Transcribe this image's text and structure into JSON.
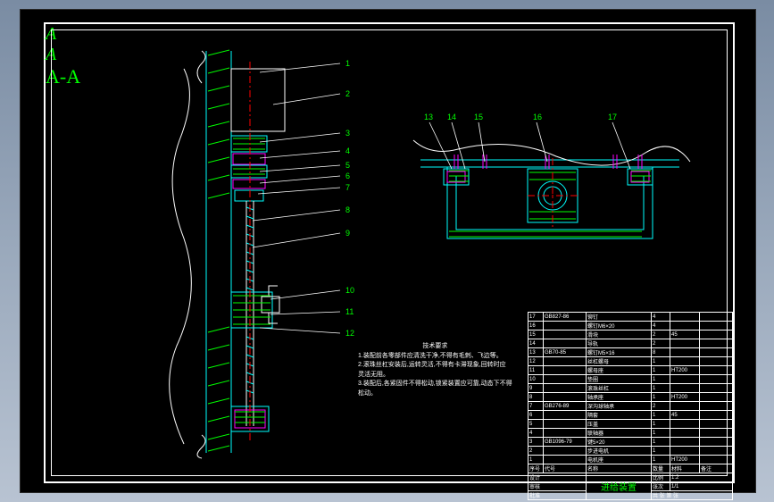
{
  "section_marker": "A",
  "section_label": "A-A",
  "callouts_left": [
    "1",
    "2",
    "3",
    "4",
    "5",
    "6",
    "7",
    "8",
    "9",
    "10",
    "11",
    "12"
  ],
  "callouts_right": [
    "13",
    "14",
    "15",
    "16",
    "17"
  ],
  "notes": {
    "title": "技术要求",
    "line1": "1.装配前各零部件应清洗干净,不得有毛刺、飞边等。",
    "line2": "2.滚珠丝杠安装后,运转灵活,不得有卡滞现象,回转时应",
    "line2b": "  灵活无阻。",
    "line3": "3.装配后,各紧固件不得松动,锁紧装置应可靠,动态下不得",
    "line3b": "  松动。"
  },
  "bom": [
    {
      "no": "17",
      "code": "GB827-86",
      "name": "铆钉",
      "qty": "4",
      "mat": "",
      "note": ""
    },
    {
      "no": "16",
      "code": "",
      "name": "螺钉M6×20",
      "qty": "4",
      "mat": "",
      "note": ""
    },
    {
      "no": "15",
      "code": "",
      "name": "滑块",
      "qty": "2",
      "mat": "45",
      "note": ""
    },
    {
      "no": "14",
      "code": "",
      "name": "导轨",
      "qty": "2",
      "mat": "",
      "note": ""
    },
    {
      "no": "13",
      "code": "GB70-85",
      "name": "螺钉M5×16",
      "qty": "8",
      "mat": "",
      "note": ""
    },
    {
      "no": "12",
      "code": "",
      "name": "丝杠螺母",
      "qty": "1",
      "mat": "",
      "note": ""
    },
    {
      "no": "11",
      "code": "",
      "name": "螺母座",
      "qty": "1",
      "mat": "HT200",
      "note": ""
    },
    {
      "no": "10",
      "code": "",
      "name": "垫圈",
      "qty": "1",
      "mat": "",
      "note": ""
    },
    {
      "no": "9",
      "code": "",
      "name": "滚珠丝杠",
      "qty": "1",
      "mat": "",
      "note": ""
    },
    {
      "no": "8",
      "code": "",
      "name": "轴承座",
      "qty": "1",
      "mat": "HT200",
      "note": ""
    },
    {
      "no": "7",
      "code": "GB276-89",
      "name": "深沟球轴承",
      "qty": "2",
      "mat": "",
      "note": ""
    },
    {
      "no": "6",
      "code": "",
      "name": "隔套",
      "qty": "1",
      "mat": "45",
      "note": ""
    },
    {
      "no": "5",
      "code": "",
      "name": "压盖",
      "qty": "1",
      "mat": "",
      "note": ""
    },
    {
      "no": "4",
      "code": "",
      "name": "联轴器",
      "qty": "1",
      "mat": "",
      "note": ""
    },
    {
      "no": "3",
      "code": "GB1096-79",
      "name": "键5×20",
      "qty": "1",
      "mat": "",
      "note": ""
    },
    {
      "no": "2",
      "code": "",
      "name": "步进电机",
      "qty": "1",
      "mat": "",
      "note": ""
    },
    {
      "no": "1",
      "code": "",
      "name": "电机座",
      "qty": "1",
      "mat": "HT200",
      "note": ""
    }
  ],
  "bom_header": {
    "no": "序号",
    "code": "代号",
    "name": "名称",
    "qty": "数量",
    "mat": "材料",
    "note": "备注"
  },
  "title_block": {
    "drawing_name": "进给装置",
    "scale": "比例",
    "scale_v": "1:2",
    "sheet": "张次",
    "sheet_v": "1/1",
    "design": "设计",
    "check": "审核",
    "appr": "批准",
    "stage": "阶段标记",
    "weight": "重量",
    "num": "共 张 第 张"
  }
}
